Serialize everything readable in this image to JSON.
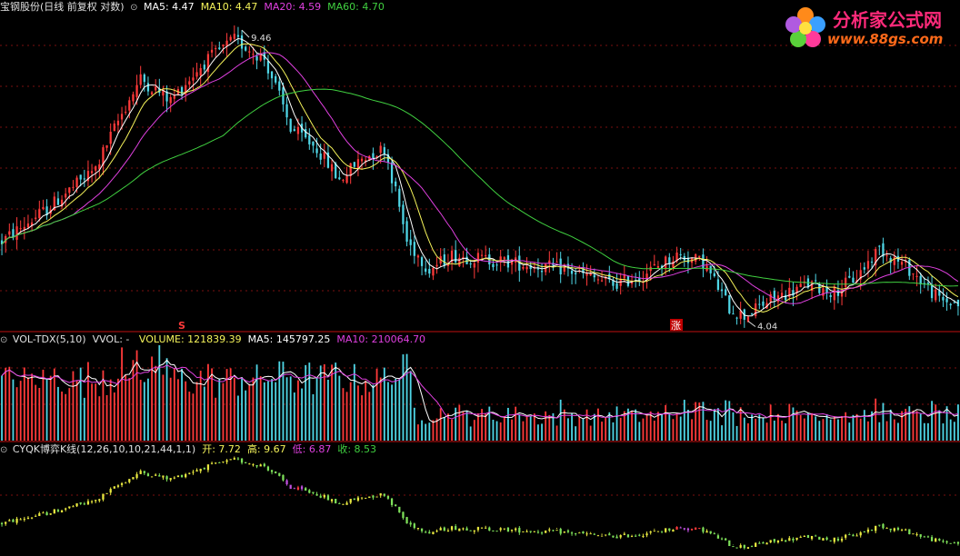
{
  "main_header": {
    "title": "宝钢股份(日线 前复权 对数)",
    "ma5": "MA5: 4.47",
    "ma10": "MA10: 4.47",
    "ma20": "MA20: 4.59",
    "ma60": "MA60: 4.70"
  },
  "vol_header": {
    "name": "VOL-TDX(5,10)",
    "vvol": "VVOL: -",
    "volume": "VOLUME: 121839.39",
    "ma5": "MA5: 145797.25",
    "ma10": "MA10: 210064.70"
  },
  "cyqk_header": {
    "name": "CYQK博弈K线(12,26,10,10,21,44,1,1)",
    "open": "开: 7.72",
    "high": "高: 9.67",
    "low": "低: 6.87",
    "close": "收: 8.53"
  },
  "logo": {
    "title": "分析家公式网",
    "url": "www.88gs.com"
  },
  "markers": {
    "high_label": "9.46",
    "low_label": "4.04",
    "signal_1": "S",
    "signal_2": "涨"
  },
  "colors": {
    "up": "#ff3a3a",
    "down": "#4fd6e6",
    "ma5": "#ffffff",
    "ma10": "#f5f35a",
    "ma20": "#e040e0",
    "ma60": "#40d040",
    "cyqk_yellow": "#e8e840",
    "cyqk_green": "#7ee05a",
    "divider": "#c01010",
    "grid": "#7a1010"
  },
  "chart_data": {
    "type": "candlestick",
    "price_anchors": [
      {
        "day": 0,
        "price": 5.1
      },
      {
        "day": 12,
        "price": 5.6
      },
      {
        "day": 25,
        "price": 6.3
      },
      {
        "day": 37,
        "price": 8.2
      },
      {
        "day": 45,
        "price": 7.7
      },
      {
        "day": 54,
        "price": 8.6
      },
      {
        "day": 62,
        "price": 9.2
      },
      {
        "day": 70,
        "price": 8.7
      },
      {
        "day": 77,
        "price": 7.1
      },
      {
        "day": 84,
        "price": 6.7
      },
      {
        "day": 90,
        "price": 6.1
      },
      {
        "day": 96,
        "price": 6.5
      },
      {
        "day": 102,
        "price": 6.7
      },
      {
        "day": 108,
        "price": 5.1
      },
      {
        "day": 114,
        "price": 4.7
      },
      {
        "day": 120,
        "price": 4.9
      },
      {
        "day": 135,
        "price": 4.8
      },
      {
        "day": 150,
        "price": 4.7
      },
      {
        "day": 163,
        "price": 4.5
      },
      {
        "day": 170,
        "price": 4.6
      },
      {
        "day": 180,
        "price": 4.9
      },
      {
        "day": 187,
        "price": 4.8
      },
      {
        "day": 194,
        "price": 4.2
      },
      {
        "day": 198,
        "price": 4.1
      },
      {
        "day": 205,
        "price": 4.3
      },
      {
        "day": 215,
        "price": 4.5
      },
      {
        "day": 222,
        "price": 4.4
      },
      {
        "day": 228,
        "price": 4.6
      },
      {
        "day": 234,
        "price": 5.0
      },
      {
        "day": 242,
        "price": 4.7
      },
      {
        "day": 250,
        "price": 4.3
      },
      {
        "day": 255,
        "price": 4.25
      }
    ],
    "high_mark": {
      "day": 64,
      "price": 9.46
    },
    "low_mark": {
      "day": 199,
      "price": 4.04
    },
    "last_bar": {
      "open": 7.72,
      "high": 9.67,
      "low": 6.87,
      "close": 8.53
    },
    "volume_last": 121839.39,
    "volume_ma5": 145797.25,
    "volume_ma10": 210064.7,
    "ma_last": {
      "ma5": 4.47,
      "ma10": 4.47,
      "ma20": 4.59,
      "ma60": 4.7
    }
  }
}
